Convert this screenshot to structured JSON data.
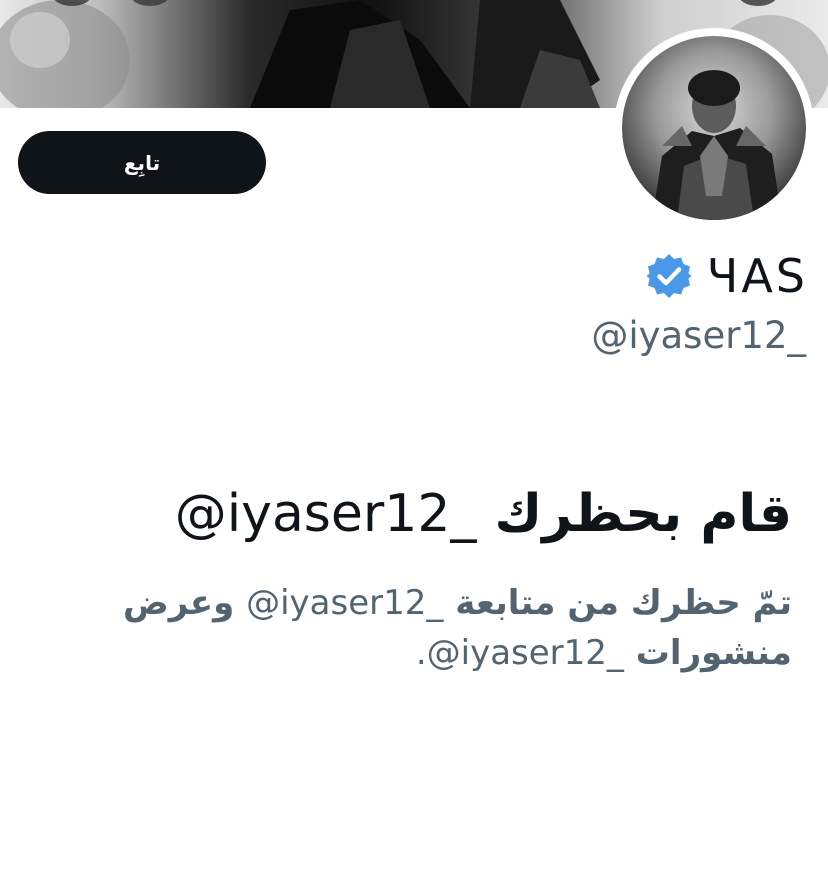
{
  "profile": {
    "display_name": "ЧAS",
    "handle": "@iyaser12_",
    "verified_color": "#4a99e9",
    "banner_style": "grayscale-photo",
    "avatar_style": "grayscale-armored-figure"
  },
  "actions": {
    "follow_label": "تابِع"
  },
  "blocked": {
    "title_handle": "@iyaser12_",
    "title_text": "قام بحظرك",
    "desc_part1": "تمّ حظرك من متابعة",
    "desc_handle1": "@iyaser12_",
    "desc_part2": "وعرض منشورات",
    "desc_handle2": "@iyaser12_",
    "desc_end": "."
  },
  "colors": {
    "button_bg": "#0f1419",
    "primary_text": "#0f1419",
    "secondary_text": "#536471",
    "verified": "#4a99e9"
  }
}
